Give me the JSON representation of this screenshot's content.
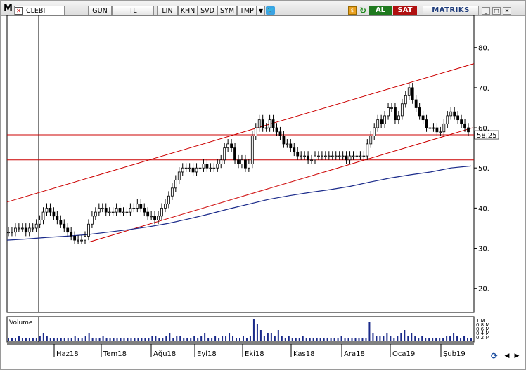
{
  "toolbar": {
    "logo": "M",
    "symbol": "CLEBI",
    "buttons": [
      "GUN",
      "TL",
      "LIN",
      "KHN",
      "SVD",
      "SYM",
      "TMP"
    ],
    "buy_label": "AL",
    "sell_label": "SAT",
    "brand": "MATRIKS"
  },
  "colors": {
    "candles": "#000000",
    "trend_lines": "#cc0000",
    "moving_average": "#1a2a8a",
    "volume": "#1a2a8a",
    "last_price_box": "#ffffff"
  },
  "chart_data": {
    "type": "candlestick",
    "price_axis_ticks": [
      "80.",
      "70.",
      "60.",
      "50.",
      "40.",
      "30.",
      "20."
    ],
    "price_axis_values": [
      80,
      70,
      60,
      50,
      40,
      30,
      20
    ],
    "last_price_label": "58.25",
    "last_price": 58.25,
    "ylim": [
      14,
      88
    ],
    "x_labels": [
      "Haz18",
      "Tem18",
      "Ağu18",
      "Eyl18",
      "Eki18",
      "Kas18",
      "Ara18",
      "Oca19",
      "Şub19"
    ],
    "horizontal_lines": [
      58.25,
      52.0
    ],
    "close_series": [
      34,
      34,
      35,
      35,
      35,
      34,
      35,
      35,
      36,
      37,
      39,
      40,
      39,
      38,
      37,
      36,
      35,
      34,
      33,
      32,
      32,
      32,
      33,
      36,
      38,
      39,
      40,
      40,
      39,
      39,
      39,
      40,
      39,
      39,
      39,
      40,
      40,
      41,
      40,
      39,
      38,
      38,
      37,
      38,
      40,
      41,
      43,
      45,
      47,
      49,
      50,
      50,
      50,
      49,
      50,
      50,
      51,
      50,
      50,
      50,
      51,
      52,
      55,
      56,
      55,
      52,
      51,
      52,
      50,
      51,
      58,
      60,
      62,
      60,
      60,
      62,
      60,
      59,
      58,
      56,
      56,
      55,
      54,
      53,
      53,
      53,
      52,
      52,
      53,
      53,
      53,
      53,
      53,
      53,
      53,
      53,
      53,
      52,
      53,
      53,
      53,
      53,
      53,
      56,
      58,
      60,
      62,
      61,
      63,
      65,
      65,
      62,
      63,
      66,
      68,
      70,
      67,
      65,
      63,
      62,
      60,
      60,
      60,
      59,
      59,
      61,
      63,
      64,
      63,
      62,
      61,
      60,
      59
    ],
    "moving_average": [
      32,
      32.3,
      32.7,
      33,
      33.4,
      34,
      34.6,
      35.3,
      36.2,
      37.3,
      38.5,
      39.8,
      41,
      42.2,
      43.1,
      43.9,
      44.6,
      45.4,
      46.5,
      47.5,
      48.3,
      49,
      50,
      50.5
    ],
    "volume_axis_ticks": [
      "1 M",
      "0.8 M",
      "0.6 M",
      "0.4 M",
      "0.2 M"
    ],
    "volume_label": "Volume",
    "volume": [
      1,
      1,
      1,
      2,
      1,
      1,
      1,
      1,
      1,
      2,
      3,
      2,
      1,
      1,
      1,
      1,
      1,
      1,
      1,
      2,
      1,
      1,
      2,
      3,
      1,
      1,
      1,
      2,
      1,
      1,
      1,
      1,
      1,
      1,
      1,
      1,
      1,
      1,
      1,
      1,
      1,
      2,
      2,
      1,
      1,
      2,
      3,
      1,
      2,
      2,
      1,
      1,
      1,
      2,
      1,
      2,
      3,
      1,
      1,
      2,
      1,
      2,
      2,
      3,
      2,
      1,
      1,
      2,
      1,
      2,
      8,
      6,
      4,
      2,
      3,
      3,
      2,
      4,
      2,
      1,
      2,
      1,
      1,
      1,
      2,
      1,
      1,
      1,
      1,
      1,
      1,
      1,
      1,
      1,
      1,
      2,
      1,
      1,
      1,
      1,
      1,
      1,
      1,
      7,
      3,
      2,
      2,
      2,
      3,
      2,
      1,
      2,
      3,
      4,
      2,
      3,
      2,
      1,
      2,
      1,
      1,
      1,
      1,
      1,
      1,
      2,
      2,
      3,
      2,
      1,
      2,
      1,
      1
    ]
  }
}
